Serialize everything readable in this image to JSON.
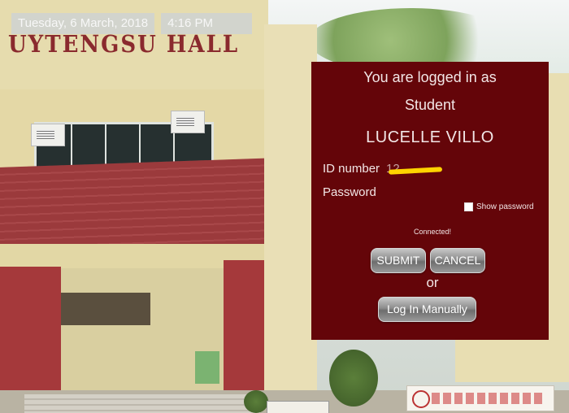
{
  "status_bar": {
    "date": "Tuesday, 6 March, 2018",
    "time": "4:16 PM"
  },
  "background": {
    "building_sign": "UYTENGSU HALL"
  },
  "login_panel": {
    "greeting_line1": "You are logged in as",
    "greeting_line2": "Student",
    "user_name": "LUCELLE VILLO",
    "id_label": "ID number",
    "id_value_visible": "12",
    "password_label": "Password",
    "show_password_label": "Show password",
    "connection_status": "Connected!",
    "submit_label": "SUBMIT",
    "cancel_label": "CANCEL",
    "or_text": "or",
    "manual_login_label": "Log In Manually",
    "panel_color": "#640509"
  }
}
